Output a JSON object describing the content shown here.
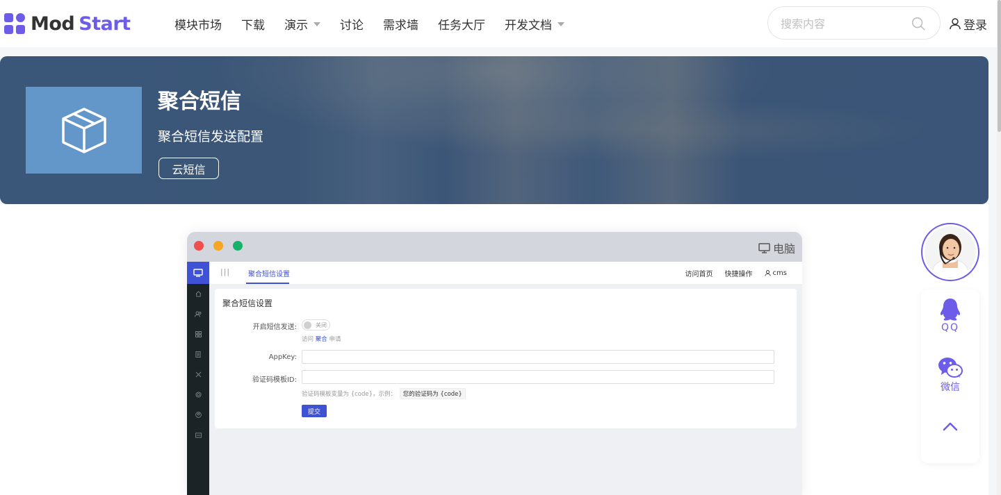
{
  "brand": {
    "name_part1": "Mod",
    "name_part2": "Start",
    "accent": "#6c5ce7"
  },
  "nav": {
    "items": [
      {
        "label": "模块市场",
        "dropdown": false
      },
      {
        "label": "下载",
        "dropdown": false
      },
      {
        "label": "演示",
        "dropdown": true
      },
      {
        "label": "讨论",
        "dropdown": false
      },
      {
        "label": "需求墙",
        "dropdown": false
      },
      {
        "label": "任务大厅",
        "dropdown": false
      },
      {
        "label": "开发文档",
        "dropdown": true
      }
    ]
  },
  "search": {
    "placeholder": "搜索内容",
    "value": ""
  },
  "login": {
    "label": "登录"
  },
  "hero": {
    "title": "聚合短信",
    "description": "聚合短信发送配置",
    "tag": "云短信",
    "thumb_icon": "box-icon",
    "thumb_color": "#6396c9"
  },
  "preview": {
    "device_label": "电脑",
    "app": {
      "tab_label": "聚合短信设置",
      "header_links": [
        "访问首页",
        "快捷操作",
        "cms"
      ],
      "card_title": "聚合短信设置",
      "fields": {
        "enable_label": "开启短信发送:",
        "toggle_text": "关闭",
        "hint_prefix": "访问",
        "hint_link": "聚合",
        "hint_suffix": "申请",
        "appkey_label": "AppKey:",
        "appkey_value": "",
        "template_label": "验证码模板ID:",
        "template_value": "",
        "template_hint": "验证码模板变量为 {code}，示例：",
        "template_example": "您的验证码为 {code}"
      },
      "submit_label": "提交",
      "accent": "#3f51d4"
    }
  },
  "float_bar": {
    "qq_label": "QQ",
    "wechat_label": "微信"
  }
}
